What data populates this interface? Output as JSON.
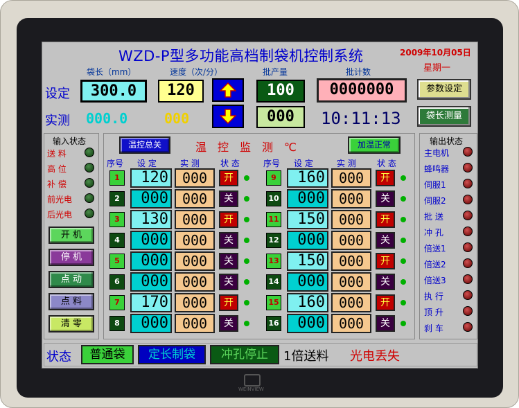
{
  "header": {
    "title": "WZD-P型多功能高档制袋机控制系统",
    "date": "2009年10月05日",
    "weekday": "星期一"
  },
  "top": {
    "col_headers": {
      "bag_length": "袋长（mm）",
      "speed": "速度（次/分）",
      "batch_qty": "批产量",
      "batch_count": "批计数"
    },
    "row_set": "设定",
    "row_actual": "实测",
    "set_bag_length": "300.0",
    "set_speed": "120",
    "set_batch_qty": "100",
    "set_batch_count": "0000000",
    "actual_bag_length": "000.0",
    "actual_speed": "000",
    "actual_batch_qty": "000",
    "time": "10:11:13",
    "btn_param": "参数设定",
    "btn_measure": "袋长测量"
  },
  "inputs": {
    "title": "输入状态",
    "items": [
      {
        "label": "送 料"
      },
      {
        "label": "高 位"
      },
      {
        "label": "补 偿"
      },
      {
        "label": "前光电"
      },
      {
        "label": "后光电"
      }
    ],
    "buttons": [
      {
        "label": "开 机",
        "color": "#5cd65c"
      },
      {
        "label": "停 机",
        "color": "#8a3a9a"
      },
      {
        "label": "点 动",
        "color": "#2f8a4a"
      },
      {
        "label": "点 料",
        "color": "#8c88c8"
      },
      {
        "label": "清 零",
        "color": "#c8e864"
      }
    ]
  },
  "temp": {
    "btn_master": "温控总关",
    "title": "温　控　监　测　℃",
    "btn_normal": "加温正常",
    "headers": {
      "idx": "序号",
      "set": "设 定",
      "actual": "实 测",
      "state": "状 态"
    },
    "left": [
      {
        "idx": "1",
        "set": "120",
        "actual": "000",
        "state": "开"
      },
      {
        "idx": "2",
        "set": "000",
        "actual": "000",
        "state": "关"
      },
      {
        "idx": "3",
        "set": "130",
        "actual": "000",
        "state": "开"
      },
      {
        "idx": "4",
        "set": "000",
        "actual": "000",
        "state": "关"
      },
      {
        "idx": "5",
        "set": "000",
        "actual": "000",
        "state": "关"
      },
      {
        "idx": "6",
        "set": "000",
        "actual": "000",
        "state": "关"
      },
      {
        "idx": "7",
        "set": "170",
        "actual": "000",
        "state": "开"
      },
      {
        "idx": "8",
        "set": "000",
        "actual": "000",
        "state": "关"
      }
    ],
    "right": [
      {
        "idx": "9",
        "set": "160",
        "actual": "000",
        "state": "开"
      },
      {
        "idx": "10",
        "set": "000",
        "actual": "000",
        "state": "关"
      },
      {
        "idx": "11",
        "set": "150",
        "actual": "000",
        "state": "开"
      },
      {
        "idx": "12",
        "set": "000",
        "actual": "000",
        "state": "关"
      },
      {
        "idx": "13",
        "set": "150",
        "actual": "000",
        "state": "开"
      },
      {
        "idx": "14",
        "set": "000",
        "actual": "000",
        "state": "关"
      },
      {
        "idx": "15",
        "set": "160",
        "actual": "000",
        "state": "开"
      },
      {
        "idx": "16",
        "set": "000",
        "actual": "000",
        "state": "关"
      }
    ]
  },
  "outputs": {
    "title": "输出状态",
    "items": [
      {
        "label": "主电机"
      },
      {
        "label": "蜂鸣器"
      },
      {
        "label": "伺服1"
      },
      {
        "label": "伺服2"
      },
      {
        "label": "批 送"
      },
      {
        "label": "冲 孔"
      },
      {
        "label": "倍送1"
      },
      {
        "label": "倍送2"
      },
      {
        "label": "倍送3"
      },
      {
        "label": "执 行"
      },
      {
        "label": "顶 升"
      },
      {
        "label": "刹 车"
      }
    ]
  },
  "status": {
    "label": "状态",
    "mode1": "普通袋",
    "mode2": "定长制袋",
    "mode3": "冲孔停止",
    "feed": "1倍送料",
    "alarm": "光电丢失"
  },
  "brand": "WEINVIEW",
  "colors": {
    "accent": "#0000cc",
    "alarm": "#d00000",
    "on": "#c00000",
    "off": "#3a0040",
    "ok": "#5cd65c"
  }
}
